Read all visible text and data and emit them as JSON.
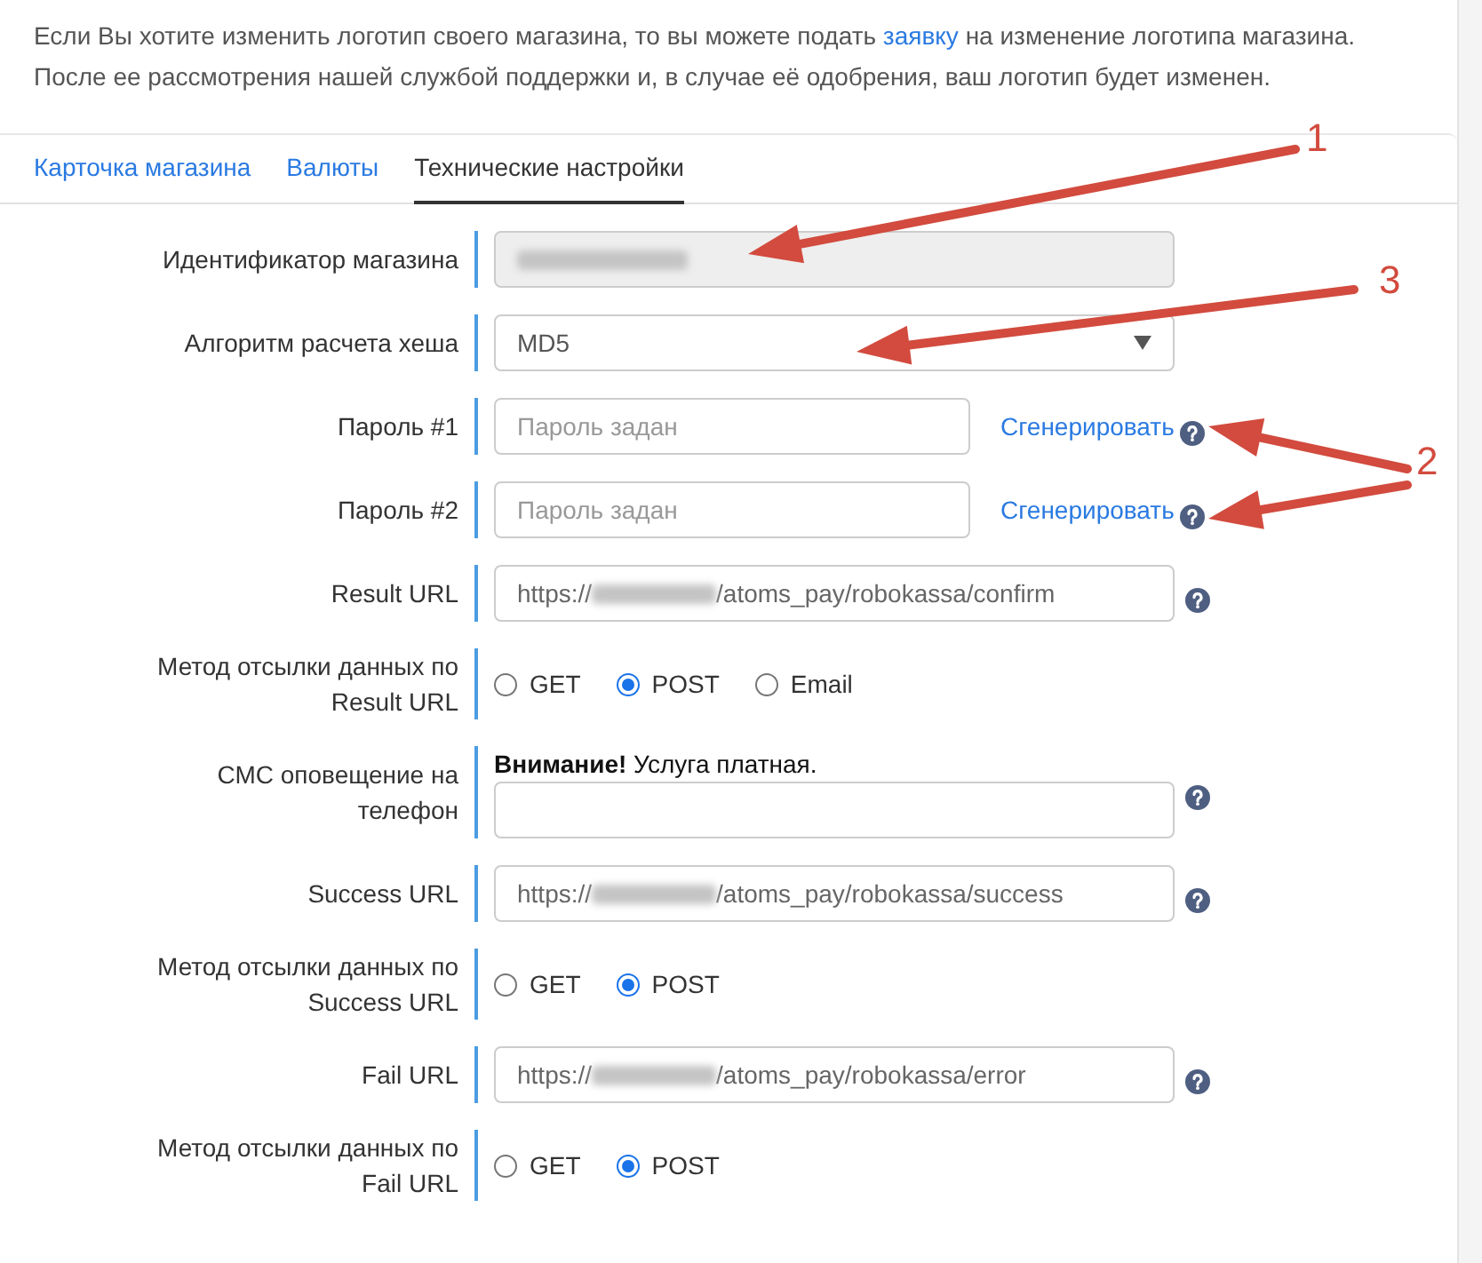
{
  "intro": {
    "before_link": "Если Вы хотите изменить логотип своего магазина, то вы можете подать ",
    "link": "заявку",
    "after_link": " на изменение логотипа магазина.",
    "second_line": "После ее рассмотрения нашей службой поддержки и, в случае её одобрения, ваш логотип будет изменен."
  },
  "tabs": [
    {
      "label": "Карточка магазина",
      "selected": false
    },
    {
      "label": "Валюты",
      "selected": false
    },
    {
      "label": "Технические настройки",
      "selected": true
    }
  ],
  "fields": [
    {
      "kind": "text",
      "label_lines": [
        "Идентификатор магазина"
      ],
      "disabled": true,
      "redacted": true
    },
    {
      "kind": "select",
      "label_lines": [
        "Алгоритм расчета хеша"
      ],
      "value": "MD5"
    },
    {
      "kind": "password",
      "label_lines": [
        "Пароль #1"
      ],
      "placeholder": "Пароль задан",
      "link": "Сгенерировать",
      "help": true
    },
    {
      "kind": "password",
      "label_lines": [
        "Пароль #2"
      ],
      "placeholder": "Пароль задан",
      "link": "Сгенерировать",
      "help": true
    },
    {
      "kind": "url",
      "label_lines": [
        "Result URL"
      ],
      "value_start": "https://",
      "redacted": true,
      "value_end": "/atoms_pay/robokassa/confirm",
      "help": true
    },
    {
      "kind": "radio",
      "label_lines": [
        "Метод отсылки данных по",
        "Result URL"
      ],
      "options": [
        {
          "label": "GET",
          "selected": false
        },
        {
          "label": "POST",
          "selected": true
        },
        {
          "label": "Email",
          "selected": false
        }
      ]
    },
    {
      "kind": "sms",
      "label_lines": [
        "СМС оповещение на",
        "телефон"
      ],
      "notice": "**Внимание!** Услуга платная.",
      "help": true
    },
    {
      "kind": "url",
      "label_lines": [
        "Success URL"
      ],
      "value_start": "https://",
      "redacted": true,
      "value_end": "/atoms_pay/robokassa/success",
      "help": true
    },
    {
      "kind": "radio",
      "label_lines": [
        "Метод отсылки данных по",
        "Success URL"
      ],
      "options": [
        {
          "label": "GET",
          "selected": false
        },
        {
          "label": "POST",
          "selected": true
        }
      ]
    },
    {
      "kind": "url",
      "label_lines": [
        "Fail URL"
      ],
      "value_start": "https://",
      "redacted": true,
      "value_end": "/atoms_pay/robokassa/error",
      "help": true
    },
    {
      "kind": "radio",
      "label_lines": [
        "Метод отсылки данных по",
        "Fail URL"
      ],
      "options": [
        {
          "label": "GET",
          "selected": false
        },
        {
          "label": "POST",
          "selected": true
        }
      ]
    }
  ],
  "annotations": [
    {
      "label": "1"
    },
    {
      "label": "3"
    },
    {
      "label": "2"
    }
  ]
}
